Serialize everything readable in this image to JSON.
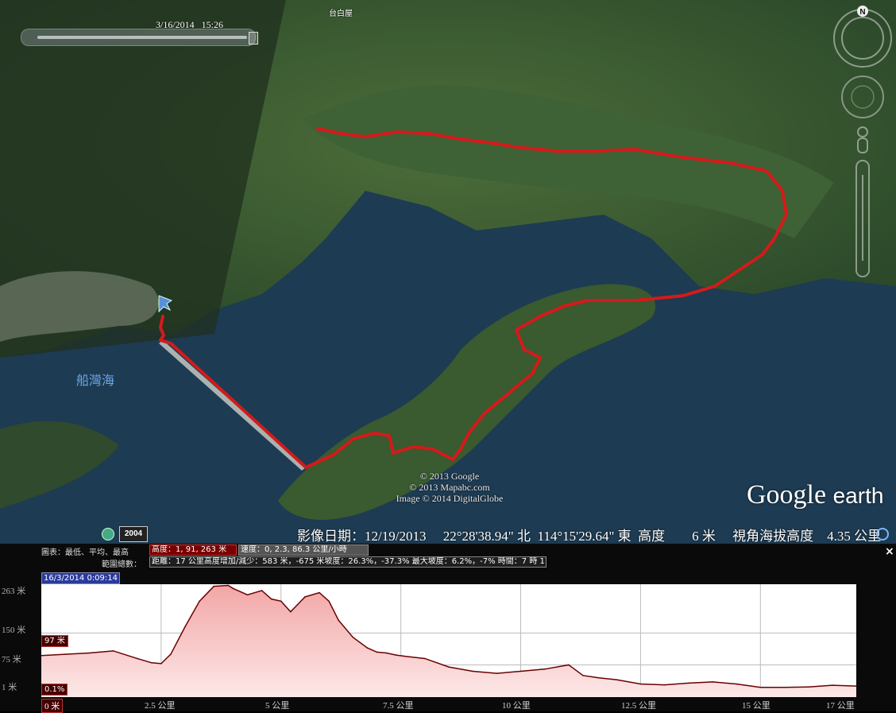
{
  "map": {
    "timestamp": "3/16/2014   15:26",
    "place_label_top": "台白屋",
    "water_label": "船灣海",
    "copyright_lines": [
      "© 2013 Google",
      "© 2013 Mapabc.com",
      "Image © 2014 DigitalGlobe"
    ],
    "logo_google": "Google",
    "logo_earth": "earth",
    "historical_year": "2004",
    "status_text": "影像日期：12/19/2013     22°28'38.94\" 北  114°15'29.64\" 東  高度        6 米     視角海拔高度    4.35 公里",
    "compass_letter": "N",
    "colors": {
      "track": "#d41a1a",
      "water": "#1d3b52",
      "land": "#34502c"
    }
  },
  "profile": {
    "info_line1_prefix": "圖表：最低、平均、最高",
    "elevation_box": "高度：1, 91, 263 米",
    "speed_box": "速度：0, 2.3, 86.3 公里/小時",
    "info_line2_prefix": "範圍總數：",
    "range_box": "距離：17 公里高度增加/減少：583 米，-675 米坡度：26.3%，-37.3% 最大坡度：6.2%，-7% 時間：7 時 17 分 13 秒",
    "close_label": "×",
    "date_tag": "16/3/2014 0:09:14",
    "cursor_value": "97 米",
    "cursor_slope": "0.1%",
    "y_ticks": [
      "263 米",
      "150 米",
      "75 米",
      "1 米"
    ],
    "x_ticks": [
      "0 米",
      "2.5 公里",
      "5 公里",
      "7.5 公里",
      "10 公里",
      "12.5 公里",
      "15 公里",
      "17 公里"
    ],
    "colors": {
      "line": "#6a0000",
      "fill_top": "#f2a6a6",
      "fill_bottom": "#fde8e8",
      "grid": "#bbbbbb"
    }
  },
  "chart_data": {
    "type": "area",
    "xlabel": "",
    "ylabel": "",
    "x_unit": "km",
    "y_unit": "m",
    "xlim": [
      0,
      17
    ],
    "ylim": [
      1,
      263
    ],
    "x": [
      0,
      0.5,
      1,
      1.5,
      2,
      2.3,
      2.5,
      2.7,
      3,
      3.3,
      3.6,
      3.9,
      4,
      4.3,
      4.6,
      4.8,
      5,
      5.2,
      5.5,
      5.8,
      6,
      6.2,
      6.5,
      6.8,
      7,
      7.2,
      7.4,
      7.6,
      8,
      8.5,
      9,
      9.5,
      10,
      10.5,
      11,
      11.3,
      11.6,
      12,
      12.5,
      13,
      13.5,
      14,
      14.5,
      15,
      15.5,
      16,
      16.5,
      17
    ],
    "y": [
      97,
      100,
      103,
      108,
      90,
      80,
      78,
      100,
      165,
      225,
      260,
      262,
      255,
      240,
      250,
      230,
      225,
      200,
      235,
      245,
      225,
      180,
      140,
      115,
      105,
      103,
      98,
      95,
      90,
      70,
      60,
      55,
      60,
      65,
      75,
      50,
      45,
      40,
      30,
      28,
      32,
      35,
      30,
      22,
      22,
      23,
      27,
      25
    ]
  }
}
